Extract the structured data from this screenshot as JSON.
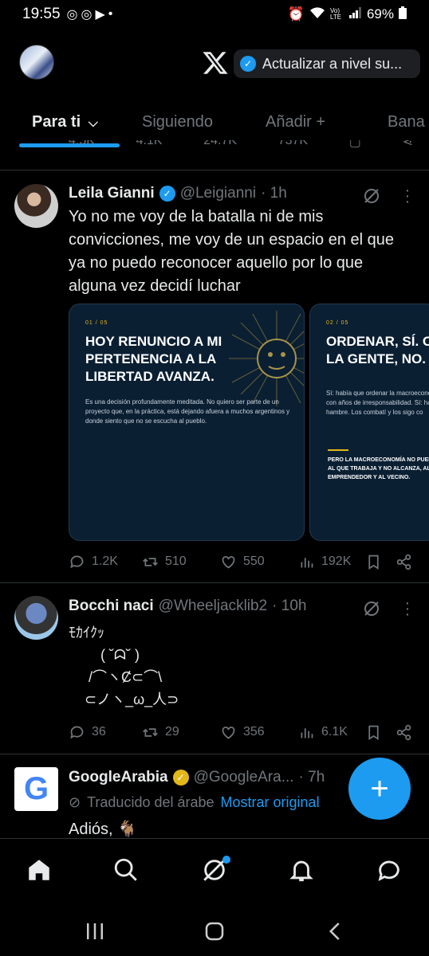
{
  "status": {
    "time": "19:55",
    "battery": "69%",
    "network": "Vo) LTE"
  },
  "header": {
    "upgrade_label": "Actualizar a nivel su..."
  },
  "tabs": [
    {
      "label": "Para ti"
    },
    {
      "label": "Siguiendo"
    },
    {
      "label": "Añadir +"
    },
    {
      "label": "Bana"
    }
  ],
  "prev_tweet": {
    "replies": "4.5K",
    "reposts": "4.1K",
    "likes": "24.7K",
    "views": "737K"
  },
  "tweets": [
    {
      "name": "Leila Gianni",
      "handle": "@Leigianni",
      "time": "· 1h",
      "text": "Yo no me voy de la batalla ni de mis\nconvicciones, me voy de un espacio en el que\nya no puedo reconocer aquello por lo que\nalguna vez decidí luchar",
      "cards": [
        {
          "num": "01 / 05",
          "title": "HOY RENUNCIO A MI\nPERTENENCIA A LA\nLIBERTAD AVANZA.",
          "body": "Es una decisión profundamente meditada. No quiero ser parte de un proyecto que, en la práctica, está dejando afuera a muchos argentinos y donde siento que no se escucha al pueblo."
        },
        {
          "num": "02 / 05",
          "title": "ORDENAR, SÍ. O\nLA GENTE, NO.",
          "body": "Sí: había que ordenar la macroeconom con años de irresponsabilidad. Sí: hab del hambre. Los combatí y los sigo co",
          "quote": "PERO LA MACROECONOMÍA NO PUEDE AL QUE TRABAJA Y NO ALCANZA, AL C EMPRENDEDOR Y AL VECINO."
        }
      ],
      "replies": "1.2K",
      "reposts": "510",
      "likes": "550",
      "views": "192K"
    },
    {
      "name": "Bocchi naci",
      "handle": "@Wheeljacklib2",
      "time": "· 10h",
      "text": "ﾓｶｲｸｯ\n        ( ˘ᗣ˘ )\n     /⌒ヽȻ⊂⌒\\\n    ⊂ノヽ_ω_人⊃",
      "replies": "36",
      "reposts": "29",
      "likes": "356",
      "views": "6.1K"
    },
    {
      "name": "GoogleArabia",
      "handle": "@GoogleAra...",
      "time": "· 7h",
      "translated": "Traducido del árabe",
      "show_original": "Mostrar original",
      "text": "Adiós, 🐐"
    }
  ],
  "colors": {
    "accent": "#1d9bf0",
    "gold": "#e2b719",
    "muted": "#71767b"
  }
}
